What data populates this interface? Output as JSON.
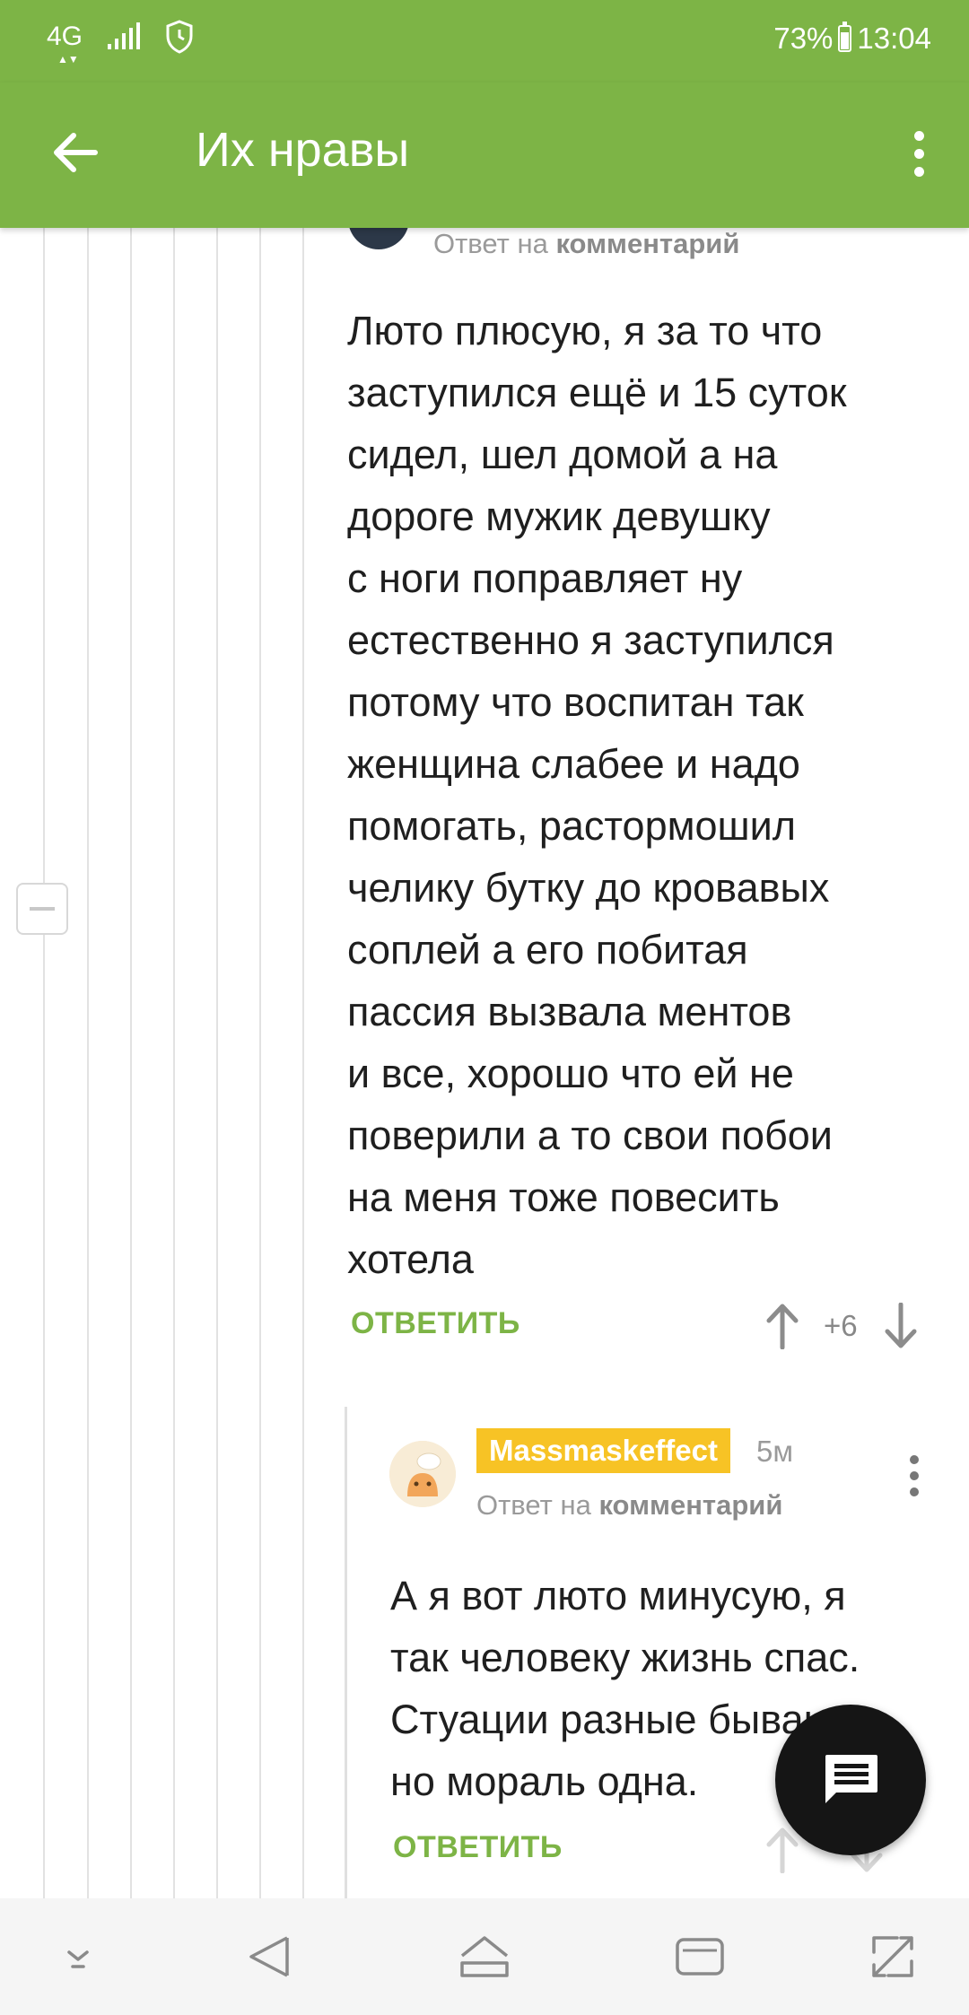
{
  "status_bar": {
    "network": "4G",
    "battery_percent": "73%",
    "time": "13:04"
  },
  "app_bar": {
    "title": "Их нравы"
  },
  "comment_main": {
    "reply_prefix": "Ответ на",
    "reply_target": "комментарий",
    "text": "Люто плюсую, я за то что\nзаступился ещё и 15 суток\nсидел, шел домой а на\nдороге мужик девушку\nс ноги поправляет ну\nестественно я заступился\nпотому что воспитан так\nженщина слабее и надо\nпомогать, растормошил\nчелику бутку до кровавых\nсоплей а его побитая\nпассия вызвала ментов\nи все, хорошо что ей не\nповерили а то свои побои\nна меня тоже повесить\nхотела",
    "reply_label": "ОТВЕТИТЬ",
    "rating": "+6"
  },
  "comment_reply": {
    "author": "Massmaskeffect",
    "time_ago": "5м",
    "reply_prefix": "Ответ на",
    "reply_target": "комментарий",
    "text": "А я вот люто минусую, я\nтак человеку жизнь спас.\nСтуации разные бывают,\nно мораль одна.",
    "reply_label": "ОТВЕТИТЬ"
  },
  "colors": {
    "accent": "#7db446",
    "author_badge": "#f7c325"
  },
  "icons": [
    "back-arrow-icon",
    "more-vert-icon",
    "shield-icon",
    "signal-icon",
    "battery-icon",
    "upvote-arrow-icon",
    "downvote-arrow-icon",
    "chat-icon",
    "nav-down-icon",
    "nav-back-icon",
    "nav-home-icon",
    "nav-recents-icon",
    "nav-expand-icon"
  ]
}
